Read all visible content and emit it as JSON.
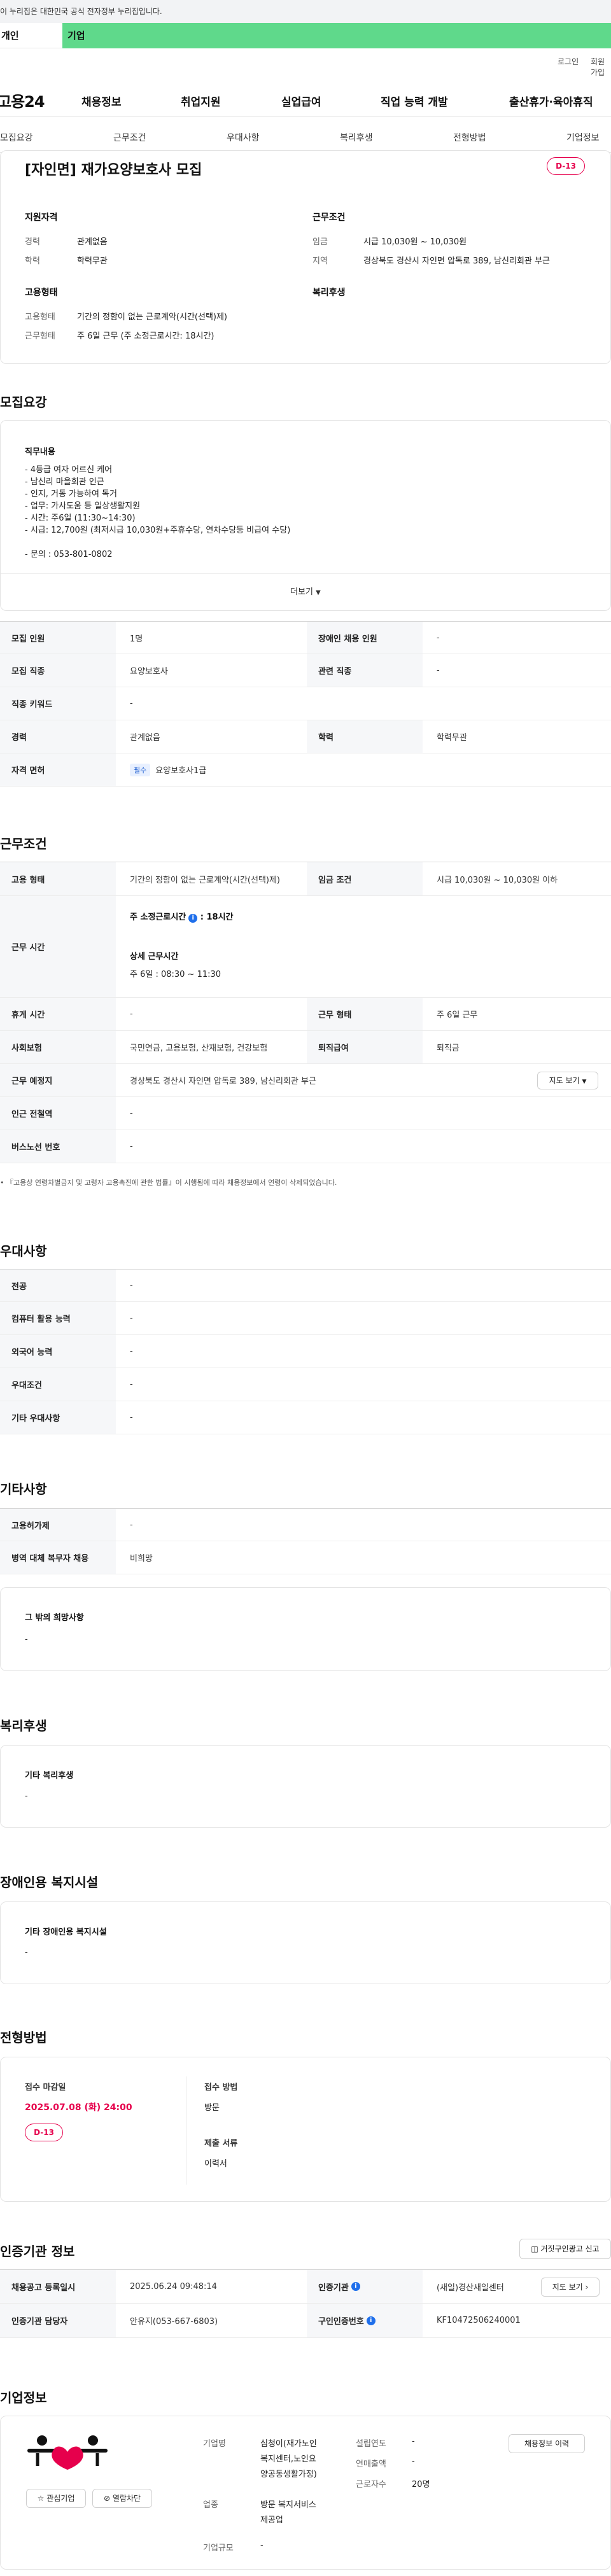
{
  "gov_banner": "이 누리집은 대한민국 공식 전자정부 누리집입니다.",
  "tabs": {
    "personal": "개인",
    "company": "기업"
  },
  "util": {
    "login": "로그인",
    "signup": "회원가입"
  },
  "header": {
    "logo": "고용24",
    "menu": [
      "채용정보",
      "취업지원",
      "실업급여",
      "직업 능력 개발",
      "출산휴가·육아휴직"
    ]
  },
  "anchor_tabs": [
    "모집요강",
    "근무조건",
    "우대사항",
    "복리후생",
    "전형방법",
    "기업정보"
  ],
  "job": {
    "title": "[자인면] 재가요양보호사 모집",
    "dday": "D-13",
    "qual_title": "지원자격",
    "career_label": "경력",
    "career_value": "관계없음",
    "edu_label": "학력",
    "edu_value": "학력무관",
    "cond_title": "근무조건",
    "wage_label": "임금",
    "wage_value": "시급 10,030원 ~ 10,030원",
    "region_label": "지역",
    "region_value": "경상북도 경산시 자인면 압독로 389, 남신리회관 부근",
    "emp_title": "고용형태",
    "emptype_label": "고용형태",
    "emptype_value": "기간의 정함이 없는 근로계약(시간(선택)제)",
    "worktype_label": "근무형태",
    "worktype_value": "주 6일 근무 (주 소정근로시간: 18시간)",
    "benefit_title": "복리후생"
  },
  "recruit": {
    "section_title": "모집요강",
    "duty_title": "직무내용",
    "duty_lines": [
      "- 4등급 여자 어르신 케어",
      "- 남신리 마을회관 인근",
      "- 인지, 거동 가능하여 독거",
      "- 업무: 가사도움 등 일상생활지원",
      "- 시간: 주6일 (11:30~14:30)",
      "- 시급: 12,700원 (최저시급 10,030원+주휴수당, 연차수당등 비급여 수당)",
      "",
      "- 문의 : 053-801-0802"
    ],
    "more": "더보기",
    "rows": [
      {
        "l1": "모집 인원",
        "v1": "1명",
        "l2": "장애인 채용 인원",
        "v2": "-"
      },
      {
        "l1": "모집 직종",
        "v1": "요양보호사",
        "l2": "관련 직종",
        "v2": "-"
      },
      {
        "l1": "직종 키워드",
        "v1": "-"
      },
      {
        "l1": "경력",
        "v1": "관계없음",
        "l2": "학력",
        "v2": "학력무관"
      },
      {
        "l1": "자격 면허",
        "badge": "필수",
        "v1": "요양보호사1급"
      }
    ]
  },
  "work": {
    "section_title": "근무조건",
    "emptype_label": "고용 형태",
    "emptype_value": "기간의 정함이 없는 근로계약(시간(선택)제)",
    "wage_label": "임금 조건",
    "wage_value": "시급 10,030원 ~ 10,030원 이하",
    "time_label": "근무 시간",
    "weekly_hours_label": "주 소정근로시간",
    "weekly_hours_value": ": 18시간",
    "detail_label": "상세 근무시간",
    "detail_value": "주 6일 : 08:30 ~ 11:30",
    "rest_label": "휴게 시간",
    "rest_value": "-",
    "form_label": "근무 형태",
    "form_value": "주 6일 근무",
    "ins_label": "사회보험",
    "ins_value": "국민연금, 고용보험, 산재보험, 건강보험",
    "sev_label": "퇴직급여",
    "sev_value": "퇴직금",
    "place_label": "근무 예정지",
    "place_value": "경상북도 경산시 자인면 압독로 389, 남신리회관 부근",
    "map_btn": "지도 보기",
    "subway_label": "인근 전철역",
    "subway_value": "-",
    "bus_label": "버스노선 번호",
    "bus_value": "-",
    "notice": "『고용상 연령차별금지 및 고령자 고용촉진에 관한 법률』이 시행됨에 따라 채용정보에서 연령이 삭제되었습니다."
  },
  "pref": {
    "section_title": "우대사항",
    "rows": [
      {
        "label": "전공",
        "value": "-"
      },
      {
        "label": "컴퓨터 활용 능력",
        "value": "-"
      },
      {
        "label": "외국어 능력",
        "value": "-"
      },
      {
        "label": "우대조건",
        "value": "-"
      },
      {
        "label": "기타 우대사항",
        "value": "-"
      }
    ]
  },
  "etc": {
    "section_title": "기타사항",
    "rows": [
      {
        "label": "고용허가제",
        "value": "-"
      },
      {
        "label": "병역 대체 복무자 채용",
        "value": "비희망"
      }
    ],
    "other_title": "그 밖의 희망사항",
    "other_value": "-"
  },
  "welfare": {
    "section_title": "복리후생",
    "box_title": "기타 복리후생",
    "box_value": "-"
  },
  "disab": {
    "section_title": "장애인용 복지시설",
    "box_title": "기타 장애인용 복지시설",
    "box_value": "-"
  },
  "process": {
    "section_title": "전형방법",
    "deadline_label": "접수 마감일",
    "deadline_value": "2025.07.08 (화) 24:00",
    "dday": "D-13",
    "method_label": "접수 방법",
    "method_value": "방문",
    "docs_label": "제출 서류",
    "docs_value": "이력서"
  },
  "cert": {
    "section_title": "인증기관 정보",
    "report_btn": "거짓구인광고 신고",
    "rows": [
      {
        "l1": "채용공고 등록일시",
        "v1": "2025.06.24 09:48:14",
        "l2": "인증기관",
        "v2": "(새일)경산새일센터",
        "btn": "지도 보기"
      },
      {
        "l1": "인증기관 담당자",
        "v1": "안유지(053-667-6803)",
        "l2": "구인인증번호",
        "v2": "KF10472506240001"
      }
    ]
  },
  "company": {
    "section_title": "기업정보",
    "fav_btn": "관심기업",
    "block_btn": "열람차단",
    "name_label": "기업명",
    "name_value": [
      "심청이(재가노인",
      "복지센터,노인요",
      "양공동생활가정)"
    ],
    "industry_label": "업종",
    "industry_value": [
      "방문 복지서비스",
      "제공업"
    ],
    "size_label": "기업규모",
    "size_value": "-",
    "founded_label": "설립연도",
    "founded_value": "-",
    "revenue_label": "연매출액",
    "revenue_value": "-",
    "employees_label": "근로자수",
    "employees_value": "20명",
    "info_btn": "채용정보 이력",
    "accent_color": "#e6004c"
  }
}
